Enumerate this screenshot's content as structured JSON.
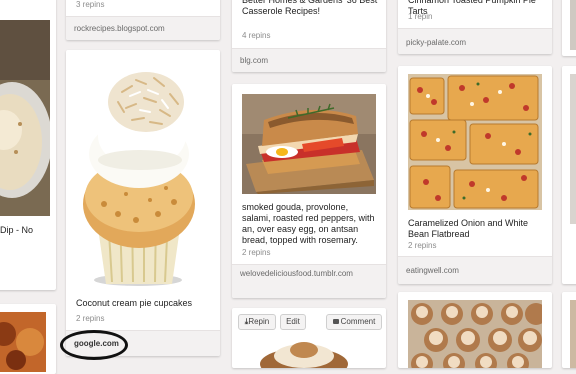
{
  "pins": [
    {
      "id": "rock-recipes",
      "stats": "3 repins",
      "source": "rockrecipes.blogspot.com"
    },
    {
      "id": "casserole",
      "description": "Better Homes & Gardens' 36 Best Casserole Recipes!",
      "stats": "4 repins",
      "source": "blg.com"
    },
    {
      "id": "pumpkin-pie-tarts",
      "description": "Cinnamon Toasted Pumpkin Pie Tarts",
      "stats": "1 repin",
      "source": "picky-palate.com"
    },
    {
      "id": "left-partial",
      "description": "Dip - No"
    },
    {
      "id": "coconut-cupcakes",
      "description": "Coconut cream pie cupcakes",
      "stats": "2 repins",
      "source": "google.com"
    },
    {
      "id": "sandwich",
      "description": "smoked gouda, provolone, salami, roasted red peppers, with an, over easy egg, on antsan bread, topped with rosemary.",
      "stats": "2 repins",
      "source": "welovedeliciousfood.tumblr.com"
    },
    {
      "id": "flatbread",
      "description": "Caramelized Onion and White Bean Flatbread",
      "stats": "2 repins",
      "source": "eatingwell.com"
    }
  ],
  "actions": {
    "repin": "Repin",
    "edit": "Edit",
    "comment": "Comment"
  },
  "icons": [
    "pin-icon",
    "comment-icon"
  ],
  "colors": {
    "background": "#f2efef",
    "card": "#ffffff",
    "source_bar": "#f3f1f1",
    "muted_text": "#8c8c8c"
  }
}
